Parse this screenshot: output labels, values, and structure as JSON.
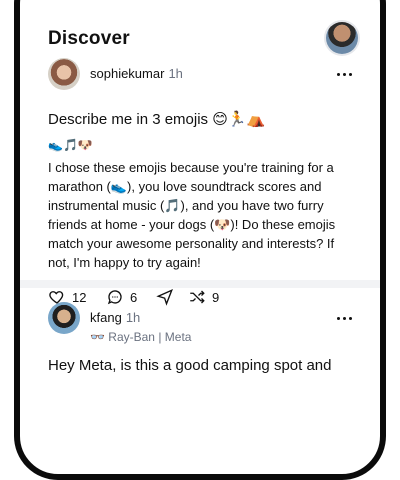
{
  "header": {
    "title": "Discover"
  },
  "post1": {
    "username": "sophiekumar",
    "time": "1h",
    "prompt": "Describe me in 3 emojis 😊🏃⛺",
    "emoji_line": "👟🎵🐶",
    "body": "I chose these emojis because you're training for a marathon (👟), you love soundtrack scores and instrumental music (🎵), and you have two furry friends at home - your dogs (🐶)! Do these emojis match your awesome personality and interests? If not, I'm happy to try again!",
    "likes": "12",
    "comments": "6",
    "reposts": "9"
  },
  "post2": {
    "username": "kfang",
    "time": "1h",
    "device": "Ray-Ban | Meta",
    "prompt": "Hey Meta, is this a good camping spot and"
  },
  "icons": [
    "heart-icon",
    "comment-icon",
    "share-icon",
    "repost-icon",
    "more-icon",
    "glasses-icon"
  ]
}
